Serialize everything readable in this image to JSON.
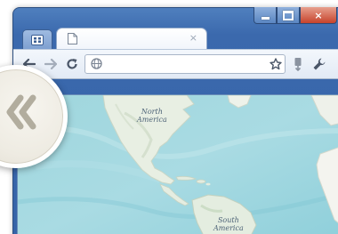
{
  "window": {
    "controls": {
      "minimize_icon": "minimize-icon",
      "maximize_icon": "maximize-icon",
      "close_label": "×"
    }
  },
  "tabs": {
    "app_tab_icon": "app-launcher-icon",
    "active_tab": {
      "icon": "blank-page-icon",
      "title": "",
      "close_label": "×"
    }
  },
  "toolbar": {
    "back_icon": "back-arrow-icon",
    "forward_icon": "forward-arrow-icon",
    "reload_icon": "reload-icon",
    "omnibox": {
      "icon": "globe-icon",
      "value": ""
    },
    "bookmark_icon": "star-icon",
    "page_menu_icon": "page-menu-icon",
    "settings_icon": "wrench-icon"
  },
  "content": {
    "map": {
      "label_north_america": "North\nAmerica",
      "label_south_america": "South\nAmerica"
    }
  },
  "overlay": {
    "nav_icon": "double-chevron-left-icon"
  },
  "colors": {
    "titlebar": "#3b69ad",
    "close_button": "#c7432b",
    "ocean": "#a6d6e0",
    "land": "#e9f0e4",
    "nav_circle": "#eeebe2",
    "chevron": "#b2ad9e"
  }
}
